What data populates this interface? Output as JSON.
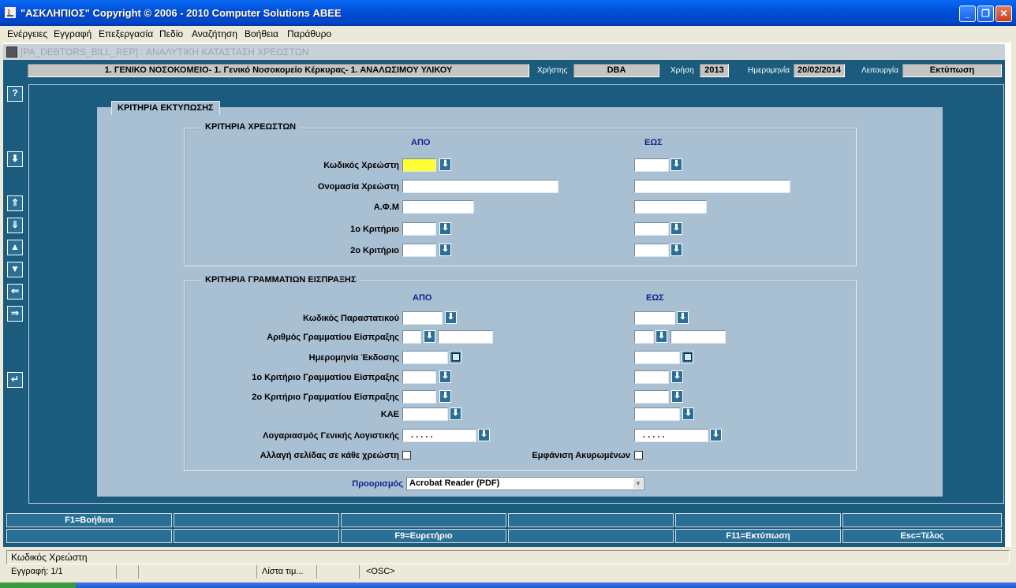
{
  "window": {
    "title": "\"ΑΣΚΛΗΠΙΟΣ\" Copyright © 2006 - 2010 Computer Solutions ΑΒΕΕ",
    "minimize": "_",
    "restore": "❐",
    "close": "✕"
  },
  "menu": [
    "Ενέργειες",
    "Εγγραφή",
    "Επεξεργασία",
    "Πεδίο",
    "Αναζήτηση",
    "Βοήθεια",
    "Παράθυρο"
  ],
  "form": {
    "title": "[PA_DEBTORS_BILL_REP]  :  ΑΝΑΛΥΤΙΚΗ ΚΑΤΑΣΤΑΣΗ ΧΡΕΩΣΤΩΝ"
  },
  "info": {
    "unit": "1. ΓΕΝΙΚΟ ΝΟΣΟΚΟΜΕΙΟ- 1. Γενικό Νοσοκομείο Κέρκυρας- 1. ΑΝΑΛΩΣΙΜΟΥ ΥΛΙΚΟΥ",
    "user_label": "Χρήστης",
    "user": "DBA",
    "year_label": "Χρήση",
    "year": "2013",
    "date_label": "Ημερομηνία",
    "date": "20/02/2014",
    "function_label": "Λειτουργία",
    "function": "Εκτύπωση"
  },
  "toolbar": {
    "help": "?",
    "lov": "⬇",
    "first": "⇑",
    "last": "⇓",
    "prev": "▲",
    "next": "▼",
    "back": "⇐",
    "forward": "⇒",
    "undo": "↵"
  },
  "criteria": {
    "tab_title": "ΚΡΙΤΗΡΙΑ ΕΚΤΥΠΩΣΗΣ",
    "debtors": {
      "title": "ΚΡΙΤΗΡΙΑ ΧΡΕΩΣΤΩΝ",
      "from": "ΑΠΟ",
      "to": "ΕΩΣ",
      "code": "Κωδικός Χρεώστη",
      "name": "Ονομασία Χρεώστη",
      "afm": "Α.Φ.Μ",
      "crit1": "1ο Κριτήριο",
      "crit2": "2ο Κριτήριο"
    },
    "receipts": {
      "title": "ΚΡΙΤΗΡΙΑ ΓΡΑΜΜΑΤΙΩΝ ΕΙΣΠΡΑΞΗΣ",
      "from": "ΑΠΟ",
      "to": "ΕΩΣ",
      "doc_code": "Κωδικός Παραστατικού",
      "receipt_no": "Αριθμός Γραμματίου Είσπραξης",
      "issue_date": "Ημερομηνία Έκδοσης",
      "crit1": "1ο Κριτήριο Γραμματίου Είσπραξης",
      "crit2": "2ο Κριτήριο Γραμματίου Είσπραξης",
      "kae": "ΚΑΕ",
      "gl_account": "Λογαριασμός Γενικής Λογιστικής",
      "gl_mask": ".  .  .  .  .",
      "page_break": "Αλλαγή σελίδας σε κάθε χρεώστη",
      "show_cancelled": "Εμφάνιση Ακυρωμένων"
    },
    "destination_label": "Προορισμός",
    "destination": "Acrobat Reader (PDF)"
  },
  "fkeys": {
    "row1": [
      "F1=Βοήθεια",
      "",
      "",
      "",
      "",
      ""
    ],
    "row2": [
      "",
      "",
      "F9=Ευρετήριο",
      "",
      "F11=Εκτύπωση",
      "Esc=Τέλος"
    ]
  },
  "status": {
    "hint": "Κωδικός Χρεώστη",
    "record": "Εγγραφή: 1/1",
    "list": "Λίστα τιμ...",
    "mode": "<OSC>"
  },
  "colors": {
    "form_bg": "#1b5c7e",
    "panel_bg": "#a9bfd2",
    "button_bg": "#2a6f95",
    "active_field": "#ffff33",
    "column_header": "#15208c"
  }
}
